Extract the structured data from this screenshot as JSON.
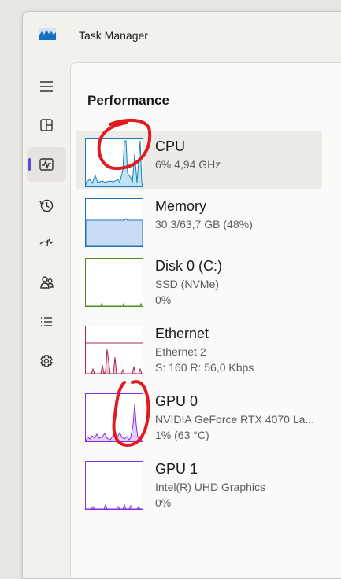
{
  "window": {
    "title": "Task Manager"
  },
  "sidebar": {
    "items": [
      {
        "name": "menu",
        "icon": "hamburger-icon"
      },
      {
        "name": "processes",
        "icon": "processes-icon"
      },
      {
        "name": "performance",
        "icon": "performance-icon",
        "active": true
      },
      {
        "name": "app-history",
        "icon": "history-icon"
      },
      {
        "name": "startup-apps",
        "icon": "startup-icon"
      },
      {
        "name": "users",
        "icon": "users-icon"
      },
      {
        "name": "details",
        "icon": "details-icon"
      },
      {
        "name": "services",
        "icon": "services-icon"
      }
    ]
  },
  "main": {
    "title": "Performance",
    "items": [
      {
        "name": "CPU",
        "line1": "6%  4,94 GHz",
        "line2": "",
        "color": "#1a7fb0",
        "selected": true
      },
      {
        "name": "Memory",
        "line1": "30,3/63,7 GB (48%)",
        "line2": "",
        "color": "#1f6fbf"
      },
      {
        "name": "Disk 0 (C:)",
        "line1": "SSD (NVMe)",
        "line2": "0%",
        "color": "#4f8a1f"
      },
      {
        "name": "Ethernet",
        "line1": "Ethernet 2",
        "line2": "S: 160  R: 56,0 Kbps",
        "color": "#a8255b"
      },
      {
        "name": "GPU 0",
        "line1": "NVIDIA GeForce RTX 4070 La...",
        "line2": "1%  (63 °C)",
        "color": "#8a2be2"
      },
      {
        "name": "GPU 1",
        "line1": "Intel(R) UHD Graphics",
        "line2": "0%",
        "color": "#8a2be2"
      }
    ]
  },
  "annotation_color": "#e2191f"
}
